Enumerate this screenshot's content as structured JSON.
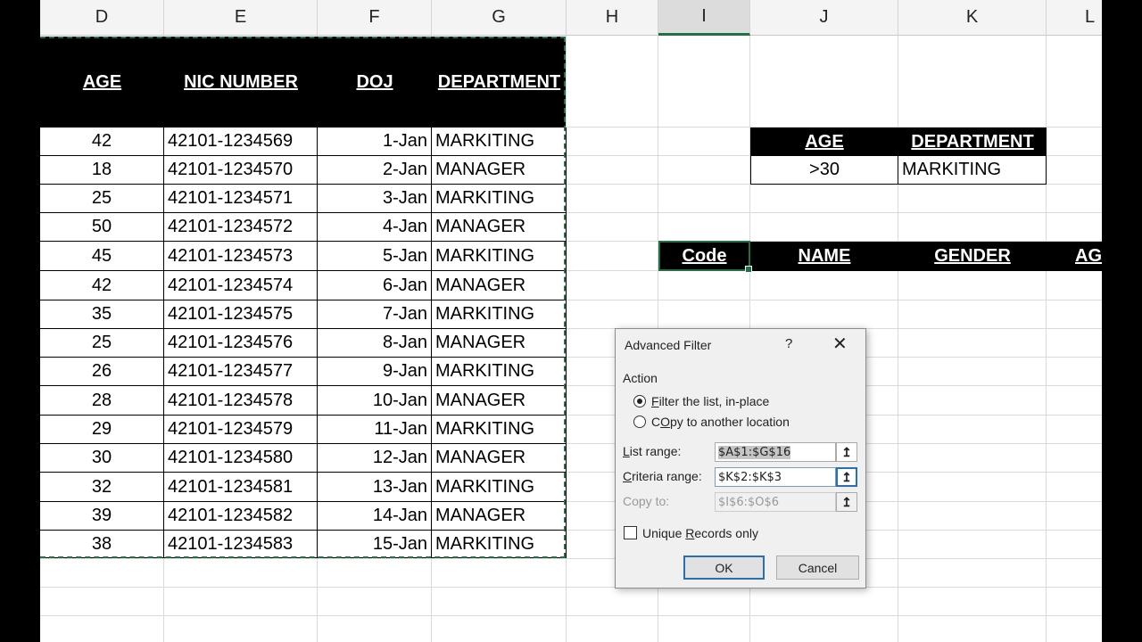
{
  "columns": [
    {
      "letter": "D"
    },
    {
      "letter": "E"
    },
    {
      "letter": "F"
    },
    {
      "letter": "G"
    },
    {
      "letter": "H"
    },
    {
      "letter": "I"
    },
    {
      "letter": "J"
    },
    {
      "letter": "K"
    },
    {
      "letter": "L"
    }
  ],
  "table": {
    "headers": [
      "AGE",
      "NIC NUMBER",
      "DOJ",
      "DEPARTMENT"
    ],
    "rows": [
      [
        "42",
        "42101-1234569",
        "1-Jan",
        "MARKITING"
      ],
      [
        "18",
        "42101-1234570",
        "2-Jan",
        "MANAGER"
      ],
      [
        "25",
        "42101-1234571",
        "3-Jan",
        "MARKITING"
      ],
      [
        "50",
        "42101-1234572",
        "4-Jan",
        "MANAGER"
      ],
      [
        "45",
        "42101-1234573",
        "5-Jan",
        "MARKITING"
      ],
      [
        "42",
        "42101-1234574",
        "6-Jan",
        "MANAGER"
      ],
      [
        "35",
        "42101-1234575",
        "7-Jan",
        "MARKITING"
      ],
      [
        "25",
        "42101-1234576",
        "8-Jan",
        "MANAGER"
      ],
      [
        "26",
        "42101-1234577",
        "9-Jan",
        "MARKITING"
      ],
      [
        "28",
        "42101-1234578",
        "10-Jan",
        "MANAGER"
      ],
      [
        "29",
        "42101-1234579",
        "11-Jan",
        "MARKITING"
      ],
      [
        "30",
        "42101-1234580",
        "12-Jan",
        "MANAGER"
      ],
      [
        "32",
        "42101-1234581",
        "13-Jan",
        "MARKITING"
      ],
      [
        "39",
        "42101-1234582",
        "14-Jan",
        "MANAGER"
      ],
      [
        "38",
        "42101-1234583",
        "15-Jan",
        "MARKITING"
      ]
    ]
  },
  "criteria": {
    "headers": [
      "AGE",
      "DEPARTMENT"
    ],
    "values": [
      ">30",
      "MARKITING"
    ]
  },
  "output": {
    "headers": [
      "Code",
      "NAME",
      "GENDER",
      "AG"
    ]
  },
  "dialog": {
    "title": "Advanced Filter",
    "help": "?",
    "close": "✕",
    "action_label": "Action",
    "option_inplace": {
      "key": "F",
      "rest": "ilter the list, in-place"
    },
    "option_copy": {
      "key": "O",
      "rest": "Copy to another location"
    },
    "list_range": {
      "label_key": "L",
      "label_rest": "ist range:",
      "value": "$A$1:$G$16"
    },
    "criteria_range": {
      "label_key": "C",
      "label_rest": "riteria range:",
      "value": "$K$2:$K$3"
    },
    "copy_to": {
      "label": "Copy to:",
      "value": "$I$6:$O$6"
    },
    "unique": {
      "key": "R",
      "before": "Unique ",
      "after": "ecords only"
    },
    "ok": "OK",
    "cancel": "Cancel",
    "ref_icon": "↥"
  }
}
